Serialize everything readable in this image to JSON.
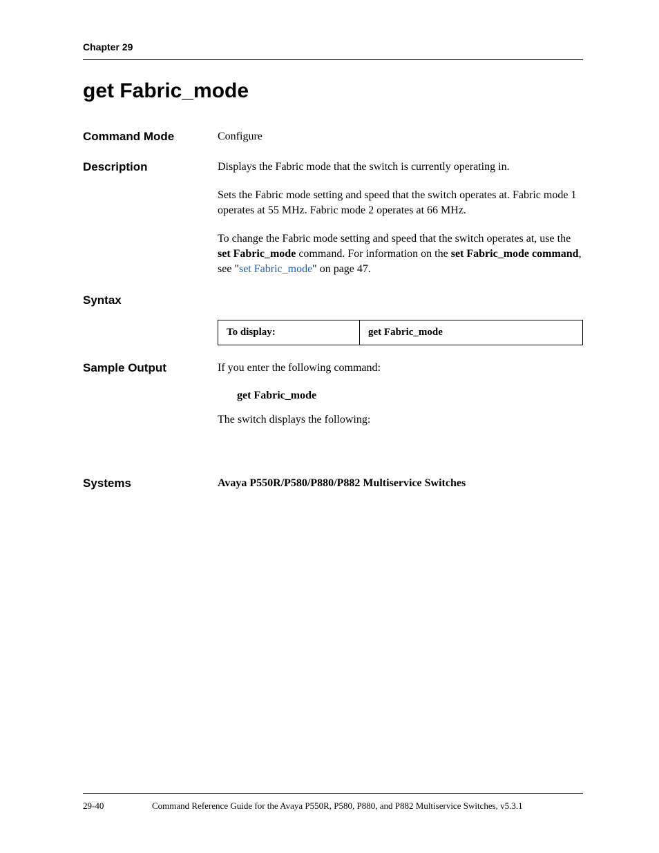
{
  "header": {
    "chapter": "Chapter 29"
  },
  "title": "get Fabric_mode",
  "sections": {
    "command_mode": {
      "label": "Command Mode",
      "value": "Configure"
    },
    "description": {
      "label": "Description",
      "p1": "Displays the Fabric mode that the switch is currently operating in.",
      "p2": "Sets the Fabric mode setting and speed that the switch operates at. Fabric mode 1 operates at 55 MHz. Fabric mode 2 operates at 66 MHz.",
      "p3_prefix": "To change the Fabric mode setting and speed that the switch operates at, use the ",
      "p3_bold1": "set Fabric_mode",
      "p3_mid1": " command. For information on the ",
      "p3_bold2": "set Fabric_mode command",
      "p3_mid2": ", see \"",
      "p3_link": "set Fabric_mode",
      "p3_suffix": "\" on page 47."
    },
    "syntax": {
      "label": "Syntax",
      "table_left": "To display:",
      "table_right": "get Fabric_mode"
    },
    "sample_output": {
      "label": "Sample Output",
      "p1": "If you enter the following command:",
      "command": "get Fabric_mode",
      "p2": "The switch displays the following:"
    },
    "systems": {
      "label": "Systems",
      "value": "Avaya P550R/P580/P880/P882 Multiservice Switches"
    }
  },
  "footer": {
    "page": "29-40",
    "text": "Command Reference Guide for the Avaya P550R, P580, P880, and P882 Multiservice Switches, v5.3.1"
  }
}
